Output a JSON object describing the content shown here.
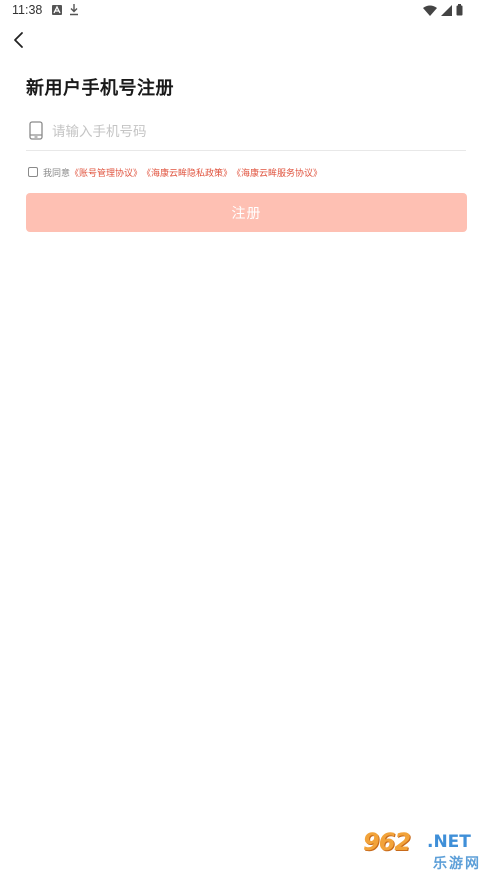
{
  "status_bar": {
    "time": "11:38",
    "icons": [
      "notification-a-icon",
      "download-icon",
      "wifi-icon",
      "signal-icon",
      "battery-icon"
    ]
  },
  "header": {
    "back_icon": "chevron-left-icon"
  },
  "page": {
    "title": "新用户手机号注册"
  },
  "phone_field": {
    "icon": "phone-icon",
    "value": "",
    "placeholder": "请输入手机号码"
  },
  "agreement": {
    "checked": false,
    "prefix": "我同意",
    "links": [
      "《账号管理协议》",
      "《海康云眸隐私政策》",
      "《海康云眸服务协议》"
    ]
  },
  "register_button": {
    "label": "注册",
    "color": "#fec0b3",
    "text_color": "#ffffff"
  },
  "colors": {
    "link": "#e0533e",
    "background": "#ffffff"
  },
  "watermark": {
    "number": "962",
    "suffix": ".NET",
    "cn": "乐游网"
  }
}
